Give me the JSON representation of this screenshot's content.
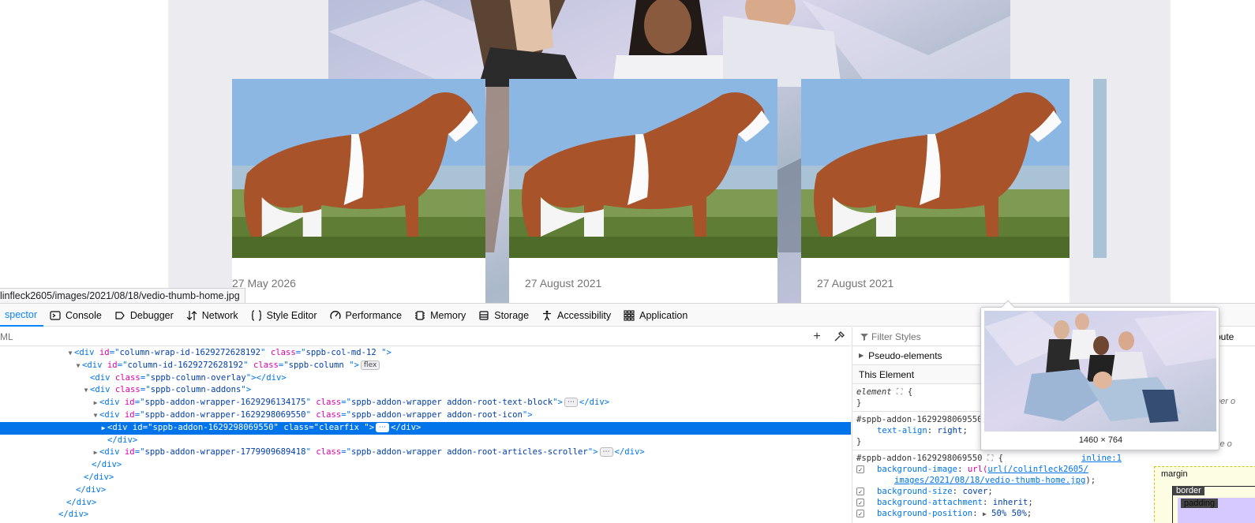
{
  "site": {
    "status_url": "linfleck2605/images/2021/08/18/vedio-thumb-home.jpg",
    "cards": [
      {
        "date": "27 May 2026",
        "image": "cow-photo"
      },
      {
        "date": "27 August 2021",
        "image": "cow-photo"
      },
      {
        "date": "27 August 2021",
        "image": "cow-photo"
      }
    ]
  },
  "devtools": {
    "tabs": [
      {
        "label": "spector",
        "icon": "inspector-icon",
        "active": true
      },
      {
        "label": "Console",
        "icon": "console-icon"
      },
      {
        "label": "Debugger",
        "icon": "debugger-icon"
      },
      {
        "label": "Network",
        "icon": "network-icon"
      },
      {
        "label": "Style Editor",
        "icon": "style-editor-icon"
      },
      {
        "label": "Performance",
        "icon": "performance-icon"
      },
      {
        "label": "Memory",
        "icon": "memory-icon"
      },
      {
        "label": "Storage",
        "icon": "storage-icon"
      },
      {
        "label": "Accessibility",
        "icon": "accessibility-icon"
      },
      {
        "label": "Application",
        "icon": "application-icon"
      }
    ],
    "markup": {
      "search_placeholder": "ML",
      "lines": [
        {
          "indent": 84,
          "twisty": "▼",
          "tag": "div",
          "attrs": [
            [
              "id",
              "column-wrap-id-1629272628192"
            ],
            [
              "class",
              "sppb-col-md-12 "
            ]
          ],
          "close": ">"
        },
        {
          "indent": 94,
          "twisty": "▼",
          "tag": "div",
          "attrs": [
            [
              "id",
              "column-id-1629272628192"
            ],
            [
              "class",
              "sppb-column "
            ]
          ],
          "close": ">",
          "badge": "flex"
        },
        {
          "indent": 104,
          "twisty": "",
          "tag": "div",
          "attrs": [
            [
              "class",
              "sppb-column-overlay"
            ]
          ],
          "close": "></div>"
        },
        {
          "indent": 104,
          "twisty": "▼",
          "tag": "div",
          "attrs": [
            [
              "class",
              "sppb-column-addons"
            ]
          ],
          "close": ">"
        },
        {
          "indent": 116,
          "twisty": "▶",
          "tag": "div",
          "attrs": [
            [
              "id",
              "sppb-addon-wrapper-1629296134175"
            ],
            [
              "class",
              "sppb-addon-wrapper addon-root-text-block"
            ]
          ],
          "close": ">",
          "badge": "⋯",
          "tail": "</div>"
        },
        {
          "indent": 116,
          "twisty": "▼",
          "tag": "div",
          "attrs": [
            [
              "id",
              "sppb-addon-wrapper-1629298069550"
            ],
            [
              "class",
              "sppb-addon-wrapper addon-root-icon"
            ]
          ],
          "close": ">"
        },
        {
          "indent": 126,
          "twisty": "▶",
          "tag": "div",
          "attrs": [
            [
              "id",
              "sppb-addon-1629298069550"
            ],
            [
              "class",
              "clearfix "
            ]
          ],
          "close": ">",
          "badge": "⋯",
          "tail": "</div>",
          "selected": true
        },
        {
          "indent": 126,
          "twisty": "",
          "text": "</div>"
        },
        {
          "indent": 116,
          "twisty": "▶",
          "tag": "div",
          "attrs": [
            [
              "id",
              "sppb-addon-wrapper-1779909689418"
            ],
            [
              "class",
              "sppb-addon-wrapper addon-root-articles-scroller"
            ]
          ],
          "close": ">",
          "badge": "⋯",
          "tail": "</div>"
        },
        {
          "indent": 106,
          "twisty": "",
          "text": "</div>"
        },
        {
          "indent": 96,
          "twisty": "",
          "text": "</div>"
        },
        {
          "indent": 86,
          "twisty": "",
          "text": "</div>"
        },
        {
          "indent": 74,
          "twisty": "",
          "text": "</div>"
        },
        {
          "indent": 64,
          "twisty": "",
          "text": "</div>"
        }
      ]
    },
    "rules": {
      "filter_placeholder": "Filter Styles",
      "pseudo_elements": "Pseudo-elements",
      "this_element": "This Element",
      "element_rule": "element",
      "rule1_selector": "#sppb-addon-1629298069550",
      "rule1_prop": "text-align",
      "rule1_value": "right",
      "rule2_selector": "#sppb-addon-1629298069550",
      "rule2_source": "inline:1",
      "bg_image_prop": "background-image",
      "bg_image_value_1": "url(/colinfleck2605/",
      "bg_image_value_2": "images/2021/08/18/vedio-thumb-home.jpg",
      "bg_size_prop": "background-size",
      "bg_size_value": "cover",
      "bg_attach_prop": "background-attachment",
      "bg_attach_value": "inherit",
      "bg_pos_prop": "background-position",
      "bg_pos_value": "50% 50%"
    },
    "layout": {
      "tab": "pute",
      "note1": "her o",
      "note2": "se o",
      "margin_label": "margin",
      "border_label": "border",
      "padding_label": "padding"
    },
    "image_tooltip": {
      "dimensions": "1460 × 764"
    }
  }
}
